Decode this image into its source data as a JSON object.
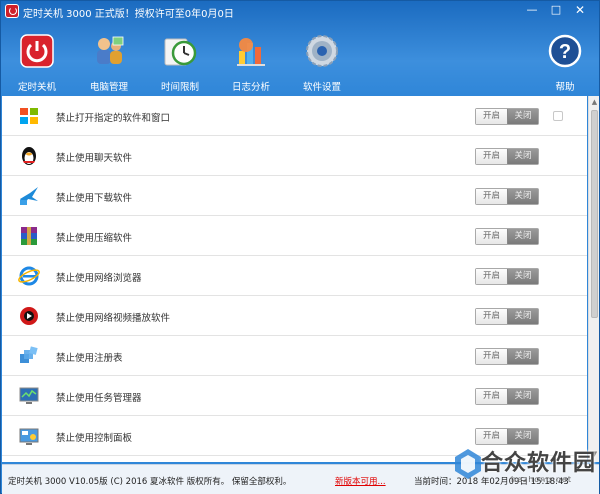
{
  "window": {
    "title": "定时关机 3000 正式版！授权许可至0年0月0日",
    "minimize": "—",
    "maximize": "□",
    "close": "✕"
  },
  "toolbar": {
    "items": [
      {
        "label": "定时关机",
        "icon": "power-icon"
      },
      {
        "label": "电脑管理",
        "icon": "computer-manage-icon"
      },
      {
        "label": "时间限制",
        "icon": "clock-icon"
      },
      {
        "label": "日志分析",
        "icon": "log-chart-icon"
      },
      {
        "label": "软件设置",
        "icon": "gear-icon"
      }
    ],
    "help": {
      "label": "帮助",
      "icon": "help-icon"
    }
  },
  "rows": [
    {
      "label": "禁止打开指定的软件和窗口",
      "icon": "windows-icon",
      "on": "开启",
      "off": "关闭"
    },
    {
      "label": "禁止使用聊天软件",
      "icon": "qq-penguin-icon",
      "on": "开启",
      "off": "关闭"
    },
    {
      "label": "禁止使用下载软件",
      "icon": "download-bird-icon",
      "on": "开启",
      "off": "关闭"
    },
    {
      "label": "禁止使用压缩软件",
      "icon": "archive-icon",
      "on": "开启",
      "off": "关闭"
    },
    {
      "label": "禁止使用网络浏览器",
      "icon": "ie-browser-icon",
      "on": "开启",
      "off": "关闭"
    },
    {
      "label": "禁止使用网络视频播放软件",
      "icon": "video-player-icon",
      "on": "开启",
      "off": "关闭"
    },
    {
      "label": "禁止使用注册表",
      "icon": "registry-icon",
      "on": "开启",
      "off": "关闭"
    },
    {
      "label": "禁止使用任务管理器",
      "icon": "task-manager-icon",
      "on": "开启",
      "off": "关闭"
    },
    {
      "label": "禁止使用控制面板",
      "icon": "control-panel-icon",
      "on": "开启",
      "off": "关闭"
    }
  ],
  "status": {
    "copyright": "定时关机 3000 V10.05版 (C) 2016  夏冰软件 版权所有。 保留全部权利。",
    "new_version": "新版本可用...",
    "time_label": "当前时间：2018 年02月09日 15:18:43"
  },
  "watermark": {
    "text": "合众软件园",
    "url": "hezhong.net"
  },
  "colors": {
    "header_blue": "#2f86d8",
    "toggle_off": "#888888",
    "new_version_red": "#e00000"
  }
}
